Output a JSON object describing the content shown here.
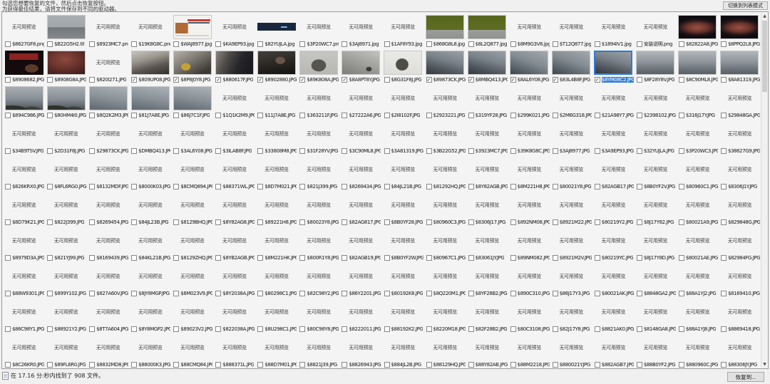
{
  "header": {
    "instructions_line1": "勾选您想要恢复的文件，然后点击恢复按钮。",
    "instructions_line2": "为获得最佳结果，请将文件保存到不同的驱动器。",
    "view_toggle_label": "切换到列表模式"
  },
  "status_bar": {
    "message": "在 17.16 分:秒内找到了 908 文件。",
    "elapsed_min_sec": "17.16",
    "files_found": 908,
    "recover_button_label": "恢复到..."
  },
  "colors": {
    "selection_blue": "#2e7bd6",
    "window_bg": "#f0f0f0",
    "panel_bg": "#f4f4f4"
  },
  "grid": {
    "no_preview_label": "无可用预览",
    "columns": 18,
    "rows": [
      [
        {
          "name": "$8627GF8.png"
        },
        {
          "name": "$B22G5H2.tif",
          "thumb": "gray-sea"
        },
        {
          "name": "$8923MC7.png"
        },
        {
          "name": "$19K8G8C.png"
        },
        {
          "name": "$WAJ8977.jpg",
          "thumb": "webpage"
        },
        {
          "name": "$KA9EP93.jpg"
        },
        {
          "name": "$82YUJLA.jpg",
          "thumb": "banner"
        },
        {
          "name": "$3P20WC7.png"
        },
        {
          "name": "$3AJ8971.jpg"
        },
        {
          "name": "$1AF8Y93.jpg"
        },
        {
          "name": "$868G8L8.jpg",
          "thumb": "green"
        },
        {
          "name": "$8L2Q877.jpg",
          "thumb": "green"
        },
        {
          "name": "$8M9G3V8.jpg"
        },
        {
          "name": "$T12Q877.jpg"
        },
        {
          "name": "$1894IV1.jpg"
        },
        {
          "name": "安装说明.png"
        },
        {
          "name": "$82822A8.JPG",
          "thumb": "arch-night"
        },
        {
          "name": "$8PPQ2L8.JPG",
          "thumb": "arch-night"
        }
      ],
      [
        {
          "name": "$8908682.JPG",
          "thumb": "dark-red-text"
        },
        {
          "name": "$8908G8A.JPG",
          "thumb": "red-crowd"
        },
        {
          "name": "$820I271.JPG"
        },
        {
          "name": "$809UP08.JPG",
          "thumb": "crowd",
          "checked": true
        },
        {
          "name": "$8P8J0Y8.JPG",
          "thumb": "crowd2",
          "checked": true
        },
        {
          "name": "$880617F.JPG",
          "thumb": "dark-building",
          "checked": true
        },
        {
          "name": "$8902880.JPG",
          "thumb": "crowd-dark",
          "checked": true
        },
        {
          "name": "$89K808A.JPG",
          "thumb": "temple-gray",
          "checked": true
        },
        {
          "name": "$8A8PT8Y.JPG",
          "thumb": "pavement",
          "checked": true
        },
        {
          "name": "$8G31F8J.JPG",
          "thumb": "pagoda-white"
        },
        {
          "name": "$89873CK.JPG",
          "thumb": "fog-roofs",
          "checked": true
        },
        {
          "name": "$8MBQ413.JPG",
          "thumb": "fog-roofs",
          "checked": true
        },
        {
          "name": "$8AL6Y08.JPG",
          "thumb": "fog-roofs2",
          "checked": true
        },
        {
          "name": "$83L4B8F.JPG",
          "thumb": "fog-roofs2",
          "checked": true
        },
        {
          "name": "$8YM08C2.JPG",
          "thumb": "fog-roofs",
          "checked": true,
          "selected": true
        },
        {
          "name": "$8F28Y8V.JPG",
          "thumb": "fog-mountain"
        },
        {
          "name": "$8C90ML8.JPG",
          "thumb": "fog-mountain"
        },
        {
          "name": "$8A81319.JPG",
          "thumb": "fog-mountain"
        }
      ],
      [
        {
          "name": "$894C986.JPG",
          "thumb": "fog-trees"
        },
        {
          "name": "$80HM4I0.JPG",
          "thumb": "fog-trees"
        },
        {
          "name": "$8Q2K2M3.JPG",
          "thumb": "fog-soft"
        },
        {
          "name": "$81J7A8E.JPG",
          "thumb": "fog-soft"
        },
        {
          "name": "$86J7C1F.JPG",
          "thumb": "fog-soft"
        },
        {
          "name": "$1Q1K2M9.JPG"
        },
        {
          "name": "$11J7A8E.JPG"
        },
        {
          "name": "$363211F.JPG"
        },
        {
          "name": "$27222A6.JPG"
        },
        {
          "name": "$2I8102F.JPG"
        },
        {
          "name": "$2923221.JPG"
        },
        {
          "name": "$319YF28.JPG"
        },
        {
          "name": "$299K021.JPG"
        },
        {
          "name": "$2M6G318.JPG"
        },
        {
          "name": "$21A98Y7.JPG"
        },
        {
          "name": "$2398102.JPG"
        },
        {
          "name": "$316J17Y.JPG"
        },
        {
          "name": "$29848GA.JPG"
        }
      ],
      [
        {
          "name": "$34B9TSV.JPG"
        },
        {
          "name": "$2D31F8J.JPG"
        },
        {
          "name": "$29873CK.JPG"
        },
        {
          "name": "$DMBQ413.JPG"
        },
        {
          "name": "$3AL6Y08.JPG"
        },
        {
          "name": "$3ILAB8F.JPG"
        },
        {
          "name": "$33808M8.JPG"
        },
        {
          "name": "$31F28YV.JPG"
        },
        {
          "name": "$3C90ML8.JPG"
        },
        {
          "name": "$3A81319.JPG"
        },
        {
          "name": "$3B22G52.JPG"
        },
        {
          "name": "$3923MC7.JPG"
        },
        {
          "name": "$39K8G8C.JPG"
        },
        {
          "name": "$3AJ8977.JPG"
        },
        {
          "name": "$3A9EP93.JPG"
        },
        {
          "name": "$32YUJLA.JPG"
        },
        {
          "name": "$3P20WC3.JPG"
        },
        {
          "name": "$38627G9.JPG"
        }
      ],
      [
        {
          "name": "$826KRX0.JPG"
        },
        {
          "name": "$8FL6RG0.JPG"
        },
        {
          "name": "$8132MDF.JPG"
        },
        {
          "name": "$8000K03.JPG"
        },
        {
          "name": "$8CMQ894.JPG"
        },
        {
          "name": "$88371WL.JPG"
        },
        {
          "name": "$8D7M021.JPG"
        },
        {
          "name": "$821J399.JPG"
        },
        {
          "name": "$8269434.JPG"
        },
        {
          "name": "$84JL21B.JPG"
        },
        {
          "name": "$81292HQ.JPG"
        },
        {
          "name": "$8Y82AGB.JPG"
        },
        {
          "name": "$8M221H8.JPG"
        },
        {
          "name": "$80021Y8.JPG"
        },
        {
          "name": "$82AGB17.JPG"
        },
        {
          "name": "$8B0YF2V.JPG"
        },
        {
          "name": "$80960C1.JPG"
        },
        {
          "name": "$8306J1Y.JPG"
        }
      ],
      [
        {
          "name": "$8D79K21.JPG"
        },
        {
          "name": "$822J399.JPG"
        },
        {
          "name": "$8269454.JPG"
        },
        {
          "name": "$84JL23B.JPG"
        },
        {
          "name": "$8129BHQ.JPG"
        },
        {
          "name": "$8Y82AG8.JPG"
        },
        {
          "name": "$89221H8.JPG"
        },
        {
          "name": "$80023Y8.JPG"
        },
        {
          "name": "$82AG817.JPG"
        },
        {
          "name": "$8B0YF28.JPG"
        },
        {
          "name": "$80960C3.JPG"
        },
        {
          "name": "$8306J17.JPG"
        },
        {
          "name": "$892NM08.JPG"
        },
        {
          "name": "$8921M22.JPG"
        },
        {
          "name": "$80219Y2.JPG"
        },
        {
          "name": "$8J17Y82.JPG"
        },
        {
          "name": "$80021A9.JPG"
        },
        {
          "name": "$829848G.JPG"
        }
      ],
      [
        {
          "name": "$8979D3A.JPG"
        },
        {
          "name": "$821YJ99.JPG"
        },
        {
          "name": "$8169439.JPG"
        },
        {
          "name": "$84KL21B.JPG"
        },
        {
          "name": "$8129ZHQ.JPG"
        },
        {
          "name": "$8YB2AGB.JPG"
        },
        {
          "name": "$8M221HK.JPG"
        },
        {
          "name": "$800R1Y8.JPG"
        },
        {
          "name": "$82AGB19.JPG"
        },
        {
          "name": "$8B0YF2W.JPG"
        },
        {
          "name": "$80967C1.JPG"
        },
        {
          "name": "$83061JY.JPG"
        },
        {
          "name": "$89NM082.JPG"
        },
        {
          "name": "$8921M2V.JPG"
        },
        {
          "name": "$80219YC.JPG"
        },
        {
          "name": "$8J17Y8D.JPG"
        },
        {
          "name": "$80021AE.JPG"
        },
        {
          "name": "$82984FG.JPG"
        }
      ],
      [
        {
          "name": "$88W9301.JPG"
        },
        {
          "name": "$899Y102.JPG"
        },
        {
          "name": "$827A60V.JPG"
        },
        {
          "name": "$8JY8MGP.JPG"
        },
        {
          "name": "$8M023V9.JPG"
        },
        {
          "name": "$8Y2038A.JPG"
        },
        {
          "name": "$80298C1.JPG"
        },
        {
          "name": "$82C98Y2.JPG"
        },
        {
          "name": "$86Y2201.JPG"
        },
        {
          "name": "$80192K8.JPG"
        },
        {
          "name": "$8Q220M1.JPG"
        },
        {
          "name": "$8YF28B2.JPG"
        },
        {
          "name": "$890C310.JPG"
        },
        {
          "name": "$86J17Y3.JPG"
        },
        {
          "name": "$80021AK.JPG"
        },
        {
          "name": "$8848GA2.JPG"
        },
        {
          "name": "$88A1YJ2.JPG"
        },
        {
          "name": "$8169410.JPG"
        }
      ],
      [
        {
          "name": "$86C98Y1.JPG"
        },
        {
          "name": "$88921Y2.JPG"
        },
        {
          "name": "$8T7A604.JPG"
        },
        {
          "name": "$8Y8MGP2.JPG"
        },
        {
          "name": "$89023V2.JPG"
        },
        {
          "name": "$822038A.JPG"
        },
        {
          "name": "$8U298C1.JPG"
        },
        {
          "name": "$80C98Y8.JPG"
        },
        {
          "name": "$8222011.JPG"
        },
        {
          "name": "$88192K2.JPG"
        },
        {
          "name": "$8220M18.JPG"
        },
        {
          "name": "$82F28B2.JPG"
        },
        {
          "name": "$80C3108.JPG"
        },
        {
          "name": "$82J17Y8.JPG"
        },
        {
          "name": "$8821AK0.JPG"
        },
        {
          "name": "$8148GA8.JPG"
        },
        {
          "name": "$88A1YJ8.JPG"
        },
        {
          "name": "$8869418.JPG"
        }
      ],
      [
        {
          "name": "$8C26KR0.JPG"
        },
        {
          "name": "$89FL6R0.JPG"
        },
        {
          "name": "$8832MD8.JPG"
        },
        {
          "name": "$88000K3.JPG"
        },
        {
          "name": "$88CMQ84.JPG"
        },
        {
          "name": "$888371L.JPG"
        },
        {
          "name": "$88D7M01.JPG"
        },
        {
          "name": "$8821J39.JPG"
        },
        {
          "name": "$8826943.JPG"
        },
        {
          "name": "$884JL2B.JPG"
        },
        {
          "name": "$88129HQ.JPG"
        },
        {
          "name": "$88Y82AB.JPG"
        },
        {
          "name": "$88M2218.JPG"
        },
        {
          "name": "$880021Y.JPG"
        },
        {
          "name": "$882AGB7.JPG"
        },
        {
          "name": "$88B0YF2.JPG"
        },
        {
          "name": "$880960C.JPG"
        },
        {
          "name": "$88306JY.JPG"
        }
      ]
    ]
  }
}
